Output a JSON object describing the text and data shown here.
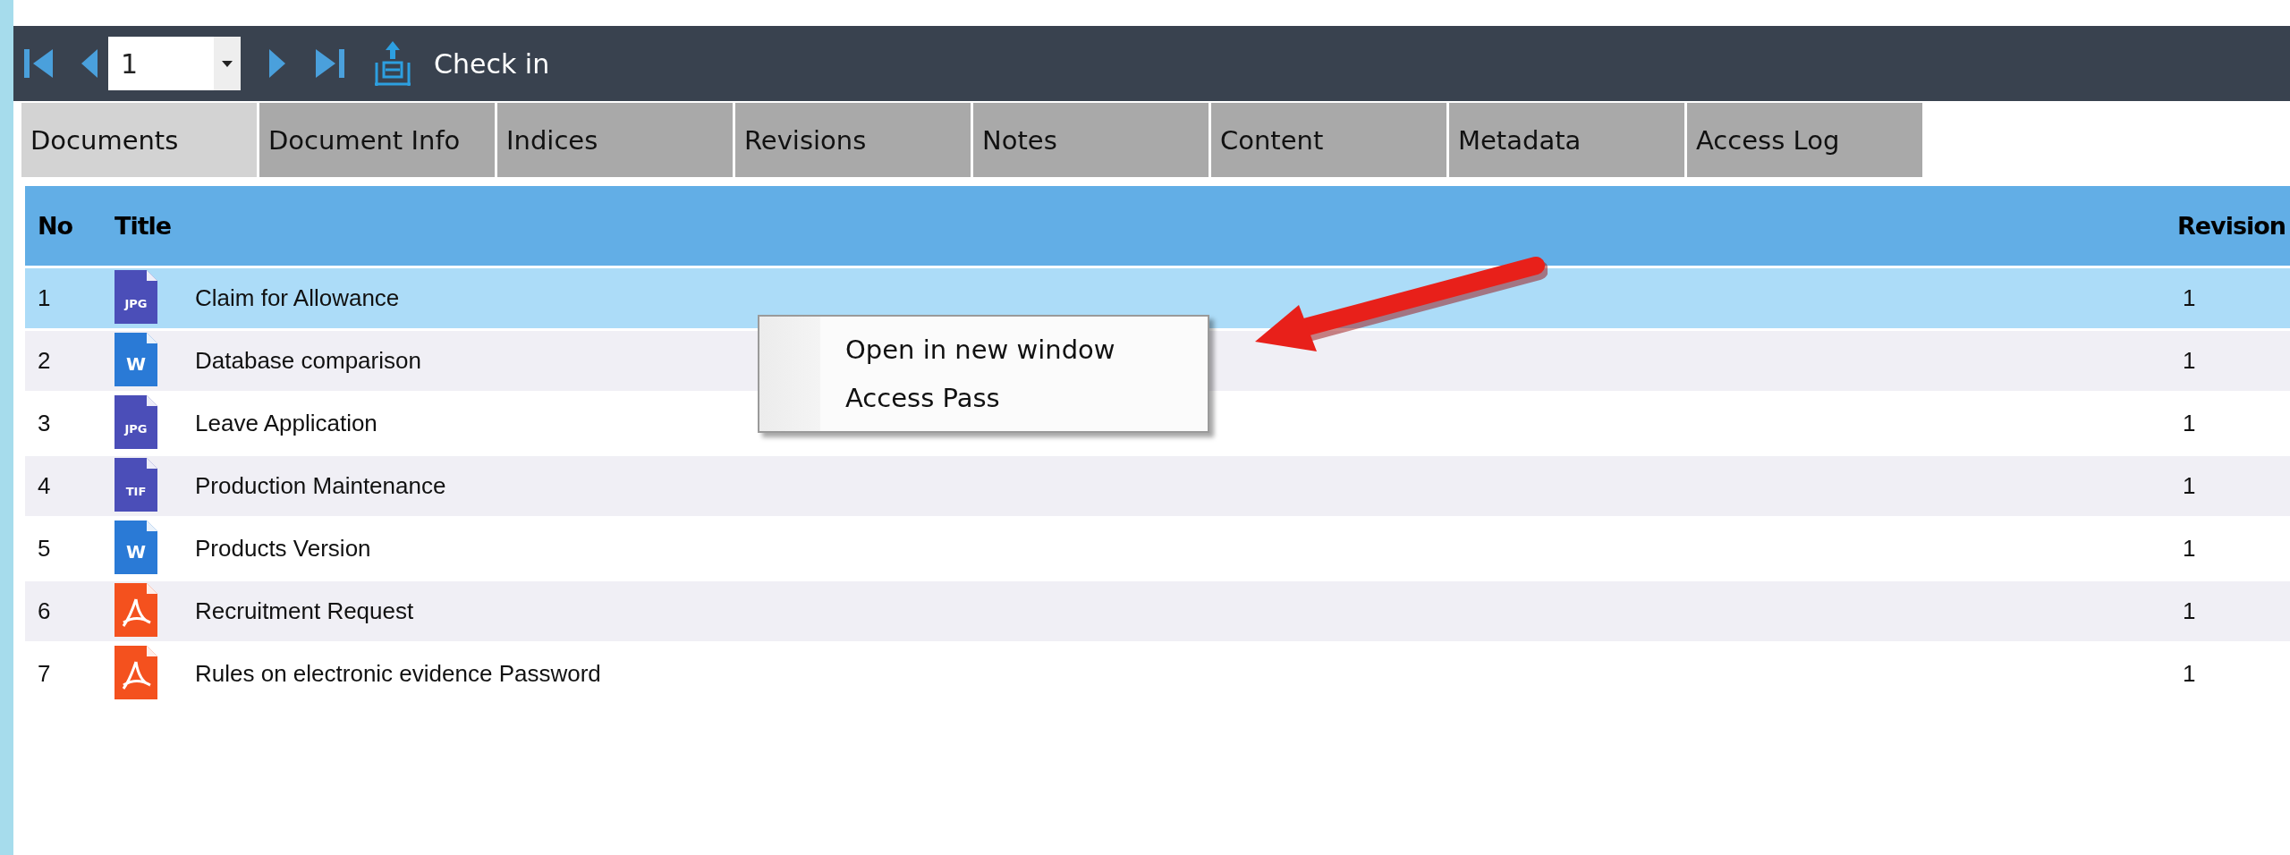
{
  "toolbar": {
    "page_select": {
      "value": "1"
    },
    "check_in": {
      "label": "Check in"
    }
  },
  "tabs": [
    {
      "label": "Documents",
      "selected": true
    },
    {
      "label": "Document Info",
      "selected": false
    },
    {
      "label": "Indices",
      "selected": false
    },
    {
      "label": "Revisions",
      "selected": false
    },
    {
      "label": "Notes",
      "selected": false
    },
    {
      "label": "Content",
      "selected": false
    },
    {
      "label": "Metadata",
      "selected": false
    },
    {
      "label": "Access Log",
      "selected": false
    }
  ],
  "table": {
    "columns": [
      "No",
      "Title",
      "Revision"
    ],
    "rows": [
      {
        "no": "1",
        "icon": {
          "kind": "image",
          "label": "JPG"
        },
        "title": "Claim for Allowance",
        "revision": "1",
        "selected": true
      },
      {
        "no": "2",
        "icon": {
          "kind": "word",
          "label": "W"
        },
        "title": "Database comparison",
        "revision": "1",
        "selected": false
      },
      {
        "no": "3",
        "icon": {
          "kind": "image",
          "label": "JPG"
        },
        "title": "Leave Application",
        "revision": "1",
        "selected": false
      },
      {
        "no": "4",
        "icon": {
          "kind": "image",
          "label": "TIF"
        },
        "title": "Production Maintenance",
        "revision": "1",
        "selected": false
      },
      {
        "no": "5",
        "icon": {
          "kind": "word",
          "label": "W"
        },
        "title": "Products Version",
        "revision": "1",
        "selected": false
      },
      {
        "no": "6",
        "icon": {
          "kind": "pdf"
        },
        "title": "Recruitment Request",
        "revision": "1",
        "selected": false
      },
      {
        "no": "7",
        "icon": {
          "kind": "pdf"
        },
        "title": "Rules on electronic evidence Password",
        "revision": "1",
        "selected": false
      }
    ]
  },
  "context_menu": {
    "items": [
      "Open in new window",
      "Access Pass"
    ]
  }
}
